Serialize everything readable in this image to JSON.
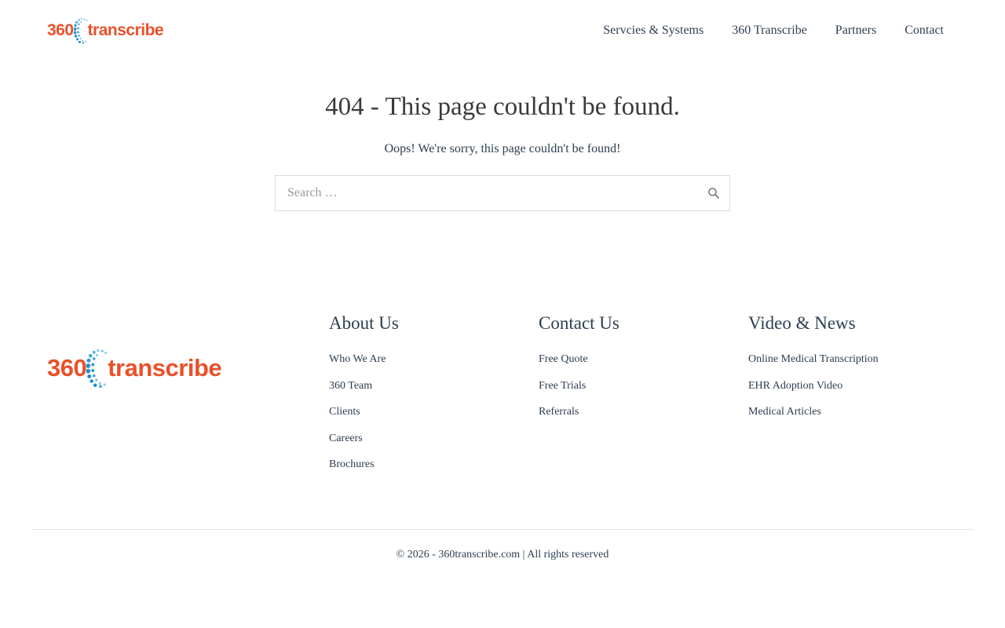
{
  "brand": {
    "logo_number": "360",
    "logo_word": "transcribe",
    "colors": {
      "orange": "#e8512b",
      "blue": "#1f8fd0",
      "light_blue": "#7ec8ea"
    }
  },
  "nav": {
    "items": [
      {
        "label": "Servcies & Systems"
      },
      {
        "label": "360 Transcribe"
      },
      {
        "label": "Partners"
      },
      {
        "label": "Contact"
      }
    ]
  },
  "main": {
    "title": "404 - This page couldn't be found.",
    "subtitle": "Oops! We're sorry, this page couldn't be found!",
    "search": {
      "placeholder": "Search …",
      "value": "",
      "icon": "search-icon"
    }
  },
  "footer": {
    "columns": [
      {
        "heading": "About Us",
        "links": [
          "Who We Are",
          "360 Team",
          "Clients",
          "Careers",
          "Brochures"
        ]
      },
      {
        "heading": "Contact Us",
        "links": [
          "Free Quote",
          "Free Trials",
          "Referrals"
        ]
      },
      {
        "heading": "Video & News",
        "links": [
          "Online Medical Transcription",
          "EHR Adoption Video",
          "Medical Articles"
        ]
      }
    ],
    "copyright": "© 2026 - 360transcribe.com | All rights reserved"
  }
}
